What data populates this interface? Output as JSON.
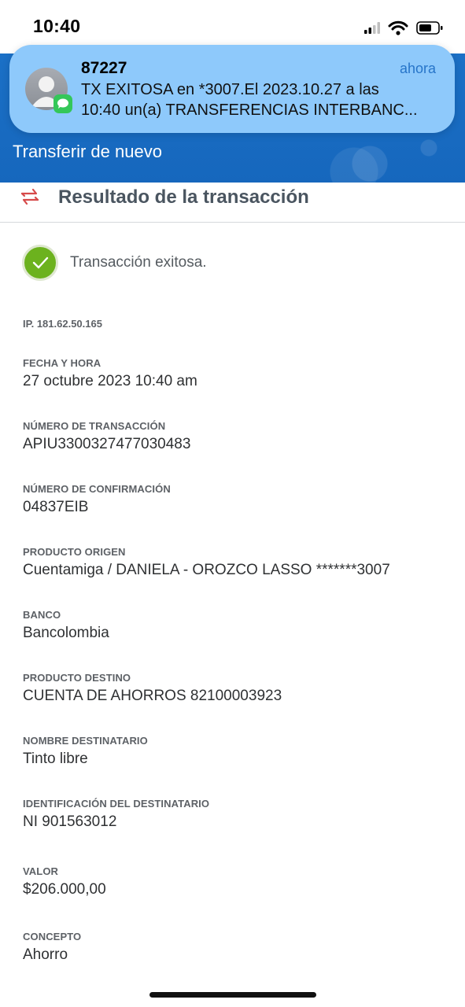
{
  "status_bar": {
    "time": "10:40",
    "icons": [
      "cellular-signal-icon",
      "wifi-icon",
      "battery-icon"
    ]
  },
  "notification": {
    "sender": "87227",
    "time": "ahora",
    "line1": "TX EXITOSA en *3007.El 2023.10.27 a las",
    "line2": "10:40 un(a) TRANSFERENCIAS INTERBANC...",
    "app_icon": "messages-icon",
    "avatar_icon": "person-icon"
  },
  "header": {
    "repeat_label": "Transferir de nuevo",
    "color": "#1a6fc4"
  },
  "section": {
    "title": "Resultado de la transacción",
    "icon": "transfer-arrows-icon",
    "icon_color": "#d64a4a"
  },
  "status": {
    "text": "Transacción exitosa.",
    "icon": "check-icon",
    "color": "#6cb21e"
  },
  "ip": "IP. 181.62.50.165",
  "fields": [
    {
      "label": "FECHA Y HORA",
      "value": "27 octubre 2023 10:40 am"
    },
    {
      "label": "NÚMERO DE TRANSACCIÓN",
      "value": "APIU3300327477030483"
    },
    {
      "label": "NÚMERO DE CONFIRMACIÓN",
      "value": "04837EIB"
    },
    {
      "label": "PRODUCTO ORIGEN",
      "value": "Cuentamiga / DANIELA - OROZCO LASSO *******3007"
    },
    {
      "label": "BANCO",
      "value": "Bancolombia"
    },
    {
      "label": "PRODUCTO DESTINO",
      "value": "CUENTA DE AHORROS 82100003923"
    },
    {
      "label": "NOMBRE DESTINATARIO",
      "value": "Tinto libre"
    },
    {
      "label": "IDENTIFICACIÓN DEL DESTINATARIO",
      "value": "NI 901563012"
    },
    {
      "label": "VALOR",
      "value": "$206.000,00"
    },
    {
      "label": "CONCEPTO",
      "value": "Ahorro"
    }
  ]
}
